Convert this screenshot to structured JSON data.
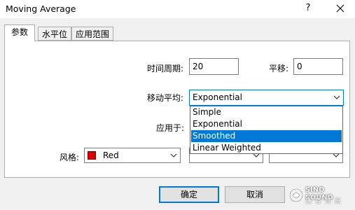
{
  "window": {
    "title": "Moving Average",
    "help_glyph": "?",
    "close_glyph": "✕"
  },
  "tabs": [
    {
      "label": "参数",
      "active": true
    },
    {
      "label": "水平位",
      "active": false
    },
    {
      "label": "应用范围",
      "active": false
    }
  ],
  "params": {
    "period_label": "时间周期:",
    "period_value": "20",
    "shift_label": "平移:",
    "shift_value": "0",
    "method_label": "移动平均:",
    "method_value": "Exponential",
    "method_options": [
      "Simple",
      "Exponential",
      "Smoothed",
      "Linear Weighted"
    ],
    "method_highlighted": "Smoothed",
    "apply_label": "应用于:",
    "style_label": "风格:",
    "color_value": "Red",
    "color_hex": "#e00000"
  },
  "buttons": {
    "ok": "确定",
    "cancel": "取消"
  },
  "watermark": {
    "line1": "SINO SOUND",
    "line2": "漢 音 資 訊"
  }
}
